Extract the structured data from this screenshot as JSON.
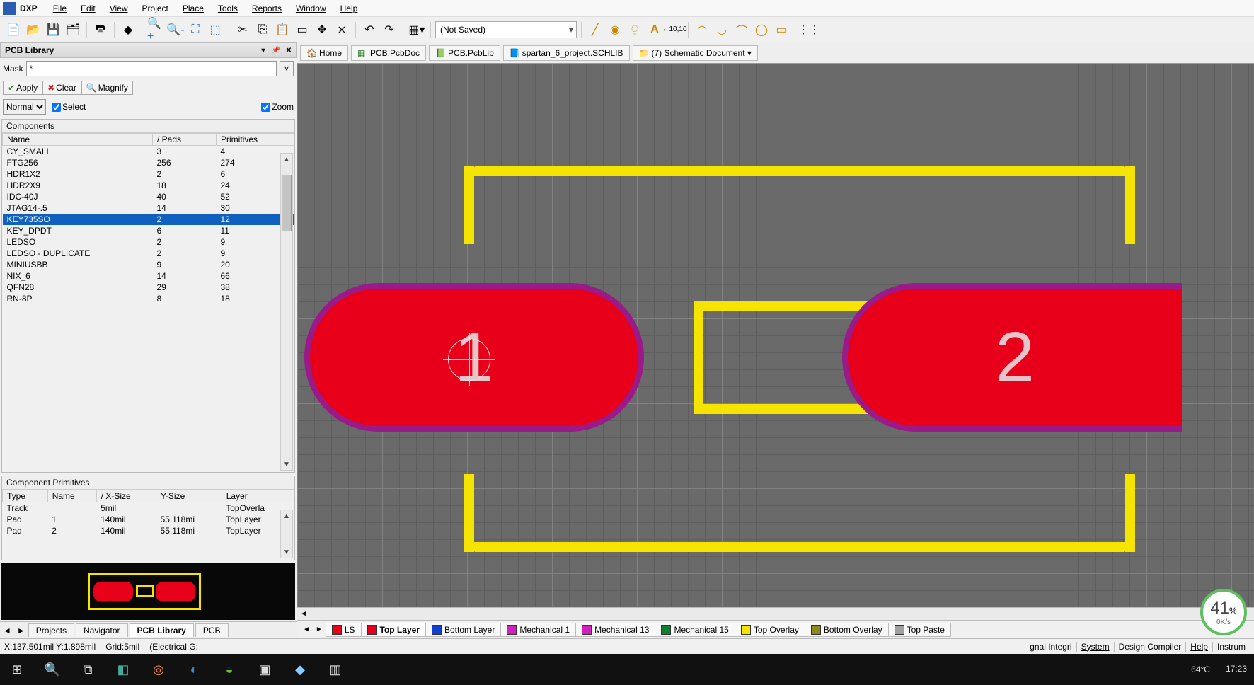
{
  "app": {
    "dxp": "DXP"
  },
  "menu": [
    "File",
    "Edit",
    "View",
    "Project",
    "Place",
    "Tools",
    "Reports",
    "Window",
    "Help"
  ],
  "toolbar": {
    "saved_combo": "(Not Saved)"
  },
  "panel": {
    "title": "PCB Library",
    "mask_label": "Mask",
    "mask_value": "*",
    "apply": "Apply",
    "clear": "Clear",
    "magnify": "Magnify",
    "mode": "Normal",
    "select": "Select",
    "zoom": "Zoom"
  },
  "components": {
    "title": "Components",
    "cols": [
      "Name",
      "Pads",
      "Primitives"
    ],
    "rows": [
      {
        "name": "CY_SMALL",
        "pads": "3",
        "prim": "4",
        "sel": false
      },
      {
        "name": "FTG256",
        "pads": "256",
        "prim": "274",
        "sel": false
      },
      {
        "name": "HDR1X2",
        "pads": "2",
        "prim": "6",
        "sel": false
      },
      {
        "name": "HDR2X9",
        "pads": "18",
        "prim": "24",
        "sel": false
      },
      {
        "name": "IDC-40J",
        "pads": "40",
        "prim": "52",
        "sel": false
      },
      {
        "name": "JTAG14-.5",
        "pads": "14",
        "prim": "30",
        "sel": false
      },
      {
        "name": "KEY735SO",
        "pads": "2",
        "prim": "12",
        "sel": true
      },
      {
        "name": "KEY_DPDT",
        "pads": "6",
        "prim": "11",
        "sel": false
      },
      {
        "name": "LEDSO",
        "pads": "2",
        "prim": "9",
        "sel": false
      },
      {
        "name": "LEDSO - DUPLICATE",
        "pads": "2",
        "prim": "9",
        "sel": false
      },
      {
        "name": "MINIUSBB",
        "pads": "9",
        "prim": "20",
        "sel": false
      },
      {
        "name": "NIX_6",
        "pads": "14",
        "prim": "66",
        "sel": false
      },
      {
        "name": "QFN28",
        "pads": "29",
        "prim": "38",
        "sel": false
      },
      {
        "name": "RN-8P",
        "pads": "8",
        "prim": "18",
        "sel": false
      }
    ]
  },
  "primitives": {
    "title": "Component Primitives",
    "cols": [
      "Type",
      "Name",
      "X-Size",
      "Y-Size",
      "Layer"
    ],
    "rows": [
      {
        "type": "Track",
        "name": "",
        "x": "5mil",
        "y": "",
        "layer": "TopOverla"
      },
      {
        "type": "Pad",
        "name": "1",
        "x": "140mil",
        "y": "55.118mi",
        "layer": "TopLayer"
      },
      {
        "type": "Pad",
        "name": "2",
        "x": "140mil",
        "y": "55.118mi",
        "layer": "TopLayer"
      }
    ]
  },
  "side_tabs": {
    "items": [
      "Projects",
      "Navigator",
      "PCB Library",
      "PCB"
    ],
    "active": 2
  },
  "doc_tabs": [
    {
      "label": "Home"
    },
    {
      "label": "PCB.PcbDoc"
    },
    {
      "label": "PCB.PcbLib"
    },
    {
      "label": "spartan_6_project.SCHLIB"
    },
    {
      "label": "(7) Schematic Document ▾"
    }
  ],
  "pads": {
    "p1": "1",
    "p2": "2"
  },
  "layers": [
    {
      "label": "LS",
      "color": "#e8001a",
      "active": false
    },
    {
      "label": "Top Layer",
      "color": "#e8001a",
      "active": true
    },
    {
      "label": "Bottom Layer",
      "color": "#1040d0",
      "active": false
    },
    {
      "label": "Mechanical 1",
      "color": "#d020c0",
      "active": false
    },
    {
      "label": "Mechanical 13",
      "color": "#d020c0",
      "active": false
    },
    {
      "label": "Mechanical 15",
      "color": "#108030",
      "active": false
    },
    {
      "label": "Top Overlay",
      "color": "#f4e400",
      "active": false
    },
    {
      "label": "Bottom Overlay",
      "color": "#8a8a20",
      "active": false
    },
    {
      "label": "Top Paste",
      "color": "#a0a0a0",
      "active": false
    }
  ],
  "status": {
    "xy": "X:137.501mil Y:1.898mil",
    "grid": "Grid:5mil",
    "snap": "(Electrical G:",
    "right": [
      "gnal Integri",
      "System",
      "Design Compiler",
      "Help",
      "Instrum"
    ]
  },
  "badge": {
    "pct": "41",
    "suffix": "%",
    "rate": "0K/s"
  },
  "taskbar": {
    "temp": "64°C",
    "time": "17:23"
  }
}
